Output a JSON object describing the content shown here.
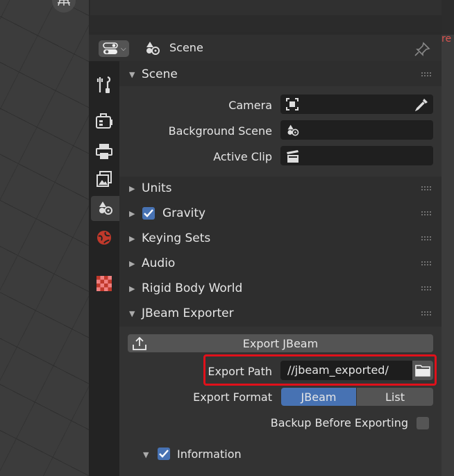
{
  "header": {
    "title": "Scene",
    "editor_type_icon": "properties-editor-icon",
    "scene_icon": "scene-icon",
    "pin_icon": "pin-icon"
  },
  "tabs": [
    {
      "name": "tool",
      "icon": "tool-icon"
    },
    {
      "name": "render",
      "icon": "render-icon"
    },
    {
      "name": "output",
      "icon": "output-icon"
    },
    {
      "name": "view-layer",
      "icon": "view-layer-icon"
    },
    {
      "name": "scene",
      "icon": "scene-icon",
      "active": true
    },
    {
      "name": "world",
      "icon": "world-icon"
    },
    {
      "name": "texture",
      "icon": "texture-icon"
    }
  ],
  "scene_panel": {
    "title": "Scene",
    "camera_label": "Camera",
    "background_scene_label": "Background Scene",
    "active_clip_label": "Active Clip"
  },
  "collapsed_panels": {
    "units": "Units",
    "gravity": "Gravity",
    "keying_sets": "Keying Sets",
    "audio": "Audio",
    "rigid_body_world": "Rigid Body World"
  },
  "jbeam_panel": {
    "title": "JBeam Exporter",
    "export_button": "Export JBeam",
    "export_path_label": "Export Path",
    "export_path_value": "//jbeam_exported/",
    "export_format_label": "Export Format",
    "format_options": [
      "JBeam",
      "List"
    ],
    "format_selected": "JBeam",
    "backup_label": "Backup Before Exporting",
    "backup_checked": false,
    "information_label": "Information",
    "information_checked": true
  },
  "partial_top_text": "re",
  "colors": {
    "accent": "#4772b3",
    "highlight_box": "#e0101a"
  }
}
